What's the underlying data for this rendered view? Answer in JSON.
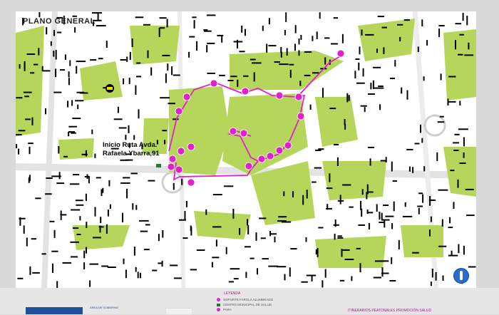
{
  "map": {
    "title": "PLANO GENERAL",
    "route_start_line1": "Inicio Ruta Avda.",
    "route_start_line2": "Rafaela Ybarra,91",
    "colors": {
      "park": "#b5d65a",
      "block": "#000000",
      "route": "#e020c8",
      "marker": "#e020c8",
      "background": "#ffffff"
    },
    "icons": [
      "bus-stop-icon",
      "route-start-marker-icon",
      "compass-icon"
    ],
    "marker_count": 20
  },
  "legend": {
    "title": "LEYENDA",
    "items": [
      {
        "label": "SOPORTE FAROLA ALUMBRADO",
        "color": "#e020c8"
      },
      {
        "label": "CENTRO MUNICIPAL DE SALUD",
        "color": "#1d7a3a"
      },
      {
        "label": "PARA",
        "color": "#e020c8"
      }
    ]
  },
  "footer": {
    "left_text": "ÁREA DE GOBIERNO",
    "right_text": "ITINERARIOS PEATONALES PROMOCIÓN SALUD"
  }
}
